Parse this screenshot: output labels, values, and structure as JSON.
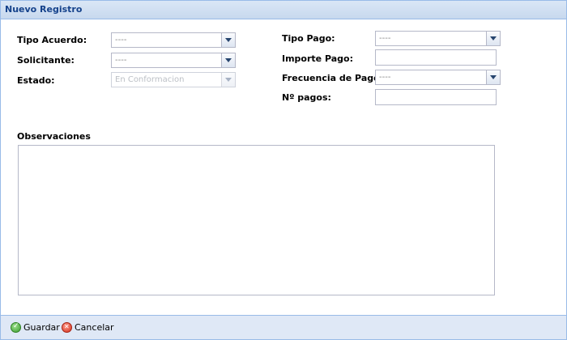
{
  "window": {
    "title": "Nuevo Registro"
  },
  "form": {
    "tipo_acuerdo": {
      "label": "Tipo Acuerdo:",
      "value": "----"
    },
    "solicitante": {
      "label": "Solicitante:",
      "value": "----"
    },
    "estado": {
      "label": "Estado:",
      "value": "En Conformacion",
      "disabled": true
    },
    "tipo_pago": {
      "label": "Tipo Pago:",
      "value": "----"
    },
    "importe_pago": {
      "label": "Importe Pago:",
      "value": ""
    },
    "frecuencia_pago": {
      "label": "Frecuencia de Pago:",
      "value": "----"
    },
    "n_pagos": {
      "label": "Nº pagos:",
      "value": ""
    },
    "observaciones": {
      "label": "Observaciones",
      "value": ""
    }
  },
  "footer": {
    "save_label": "Guardar",
    "cancel_label": "Cancelar"
  },
  "icons": {
    "save": "check-circle-icon",
    "cancel": "x-circle-icon",
    "dropdown": "chevron-down-icon"
  },
  "colors": {
    "title_text": "#15428b",
    "border": "#99bbe8",
    "footer_bg": "#dfe8f6"
  }
}
